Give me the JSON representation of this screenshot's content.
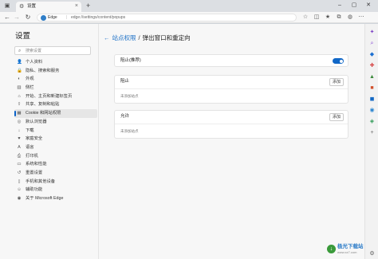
{
  "browser": {
    "tab_title": "设置",
    "addr_label": "Edge",
    "url": "edge://settings/content/popups"
  },
  "settings": {
    "title": "设置",
    "search_placeholder": "搜索设置",
    "nav": [
      {
        "label": "个人资料",
        "icon": "profile-icon",
        "glyph": "👤",
        "selected": false
      },
      {
        "label": "隐私、搜索和服务",
        "icon": "lock-icon",
        "glyph": "🔒",
        "selected": false
      },
      {
        "label": "外观",
        "icon": "appearance-icon",
        "glyph": "◐",
        "selected": false
      },
      {
        "label": "侧栏",
        "icon": "sidebar-icon",
        "glyph": "▥",
        "selected": false
      },
      {
        "label": "开始、主页和新建标签页",
        "icon": "home-icon",
        "glyph": "⌂",
        "selected": false
      },
      {
        "label": "共享、复制和粘贴",
        "icon": "share-icon",
        "glyph": "⇪",
        "selected": false
      },
      {
        "label": "Cookie 和网站权限",
        "icon": "cookie-icon",
        "glyph": "▦",
        "selected": true
      },
      {
        "label": "默认浏览器",
        "icon": "browser-icon",
        "glyph": "◎",
        "selected": false
      },
      {
        "label": "下载",
        "icon": "download-icon",
        "glyph": "↓",
        "selected": false
      },
      {
        "label": "家庭安全",
        "icon": "family-icon",
        "glyph": "♥",
        "selected": false
      },
      {
        "label": "语言",
        "icon": "language-icon",
        "glyph": "A",
        "selected": false
      },
      {
        "label": "打印机",
        "icon": "printer-icon",
        "glyph": "⎙",
        "selected": false
      },
      {
        "label": "系统和性能",
        "icon": "system-icon",
        "glyph": "▭",
        "selected": false
      },
      {
        "label": "重置设置",
        "icon": "reset-icon",
        "glyph": "↺",
        "selected": false
      },
      {
        "label": "手机和其他设备",
        "icon": "phone-icon",
        "glyph": "▯",
        "selected": false
      },
      {
        "label": "辅助功能",
        "icon": "accessibility-icon",
        "glyph": "☺",
        "selected": false
      },
      {
        "label": "关于 Microsoft Edge",
        "icon": "edge-icon",
        "glyph": "◉",
        "selected": false
      }
    ]
  },
  "page": {
    "breadcrumb_parent": "站点权限",
    "breadcrumb_sep": "/",
    "breadcrumb_current": "弹出窗口和重定向",
    "ask_label": "阻止(推荐)",
    "ask_toggle_on": true,
    "block_title": "阻止",
    "block_add": "添加",
    "block_empty": "未添加站点",
    "allow_title": "允许",
    "allow_add": "添加",
    "allow_empty": "未添加站点"
  },
  "watermark": {
    "line1": "极光下载站",
    "line2": "www.xz7.com"
  },
  "colors": {
    "accent": "#1067c7",
    "link": "#1a6fc6"
  }
}
